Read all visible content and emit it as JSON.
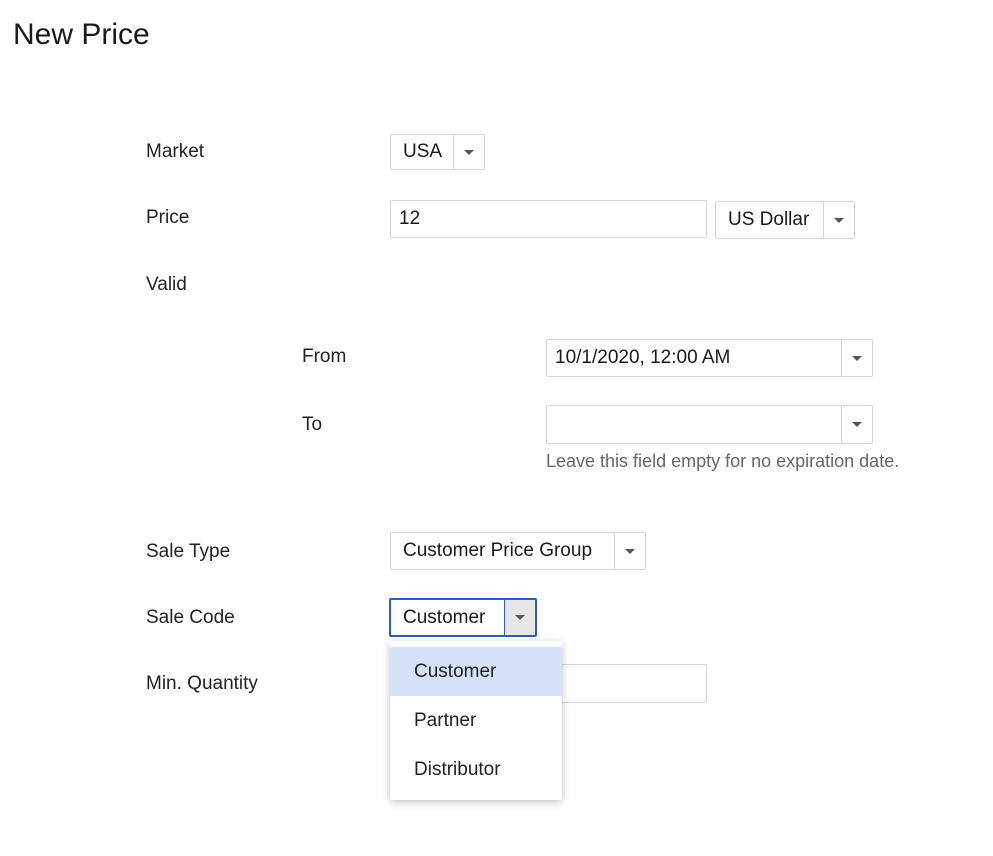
{
  "page": {
    "title": "New Price"
  },
  "market": {
    "label": "Market",
    "value": "USA"
  },
  "price": {
    "label": "Price",
    "value": "12",
    "currency": "US Dollar"
  },
  "valid": {
    "label": "Valid",
    "from": {
      "label": "From",
      "value": "10/1/2020, 12:00 AM"
    },
    "to": {
      "label": "To",
      "value": "",
      "hint": "Leave this field empty for no expiration date."
    }
  },
  "sale_type": {
    "label": "Sale Type",
    "value": "Customer Price Group"
  },
  "sale_code": {
    "label": "Sale Code",
    "value": "Customer",
    "options": [
      "Customer",
      "Partner",
      "Distributor"
    ],
    "selected_index": 0
  },
  "min_quantity": {
    "label": "Min. Quantity",
    "value": ""
  },
  "colors": {
    "focus": "#2b5fb4",
    "selected_option_bg": "#d4e1f6"
  }
}
